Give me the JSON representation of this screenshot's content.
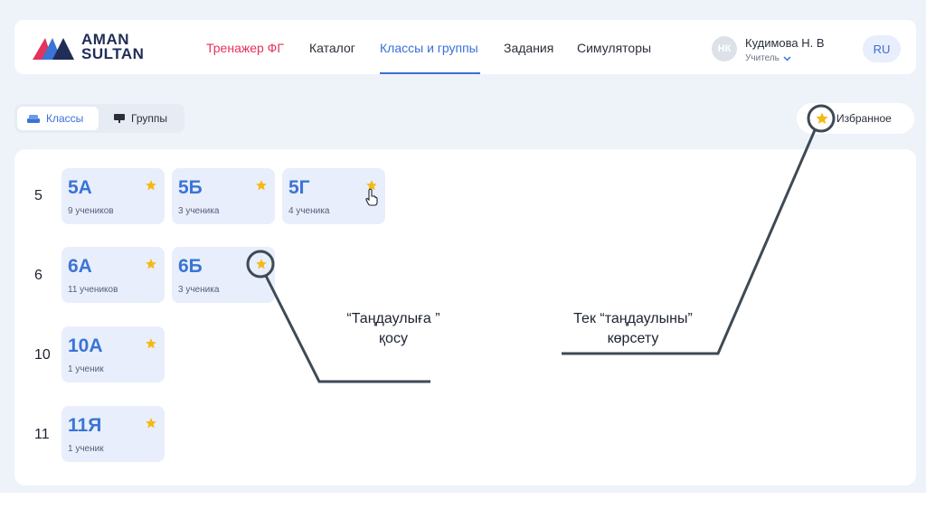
{
  "header": {
    "logo": {
      "line1": "AMAN",
      "line2": "SULTAN"
    },
    "nav": [
      {
        "label": "Тренажер ФГ"
      },
      {
        "label": "Каталог"
      },
      {
        "label": "Классы и группы"
      },
      {
        "label": "Задания"
      },
      {
        "label": "Симуляторы"
      }
    ],
    "user": {
      "initials": "НК",
      "name": "Кудимова Н. В",
      "role": "Учитель"
    },
    "lang": "RU"
  },
  "toggle": {
    "classes": "Классы",
    "groups": "Группы"
  },
  "favorites_button": "Избранное",
  "grades": [
    {
      "grade": "5",
      "classes": [
        {
          "name": "5А",
          "count": "9 учеников"
        },
        {
          "name": "5Б",
          "count": "3 ученика"
        },
        {
          "name": "5Г",
          "count": "4 ученика"
        }
      ]
    },
    {
      "grade": "6",
      "classes": [
        {
          "name": "6А",
          "count": "11 учеников"
        },
        {
          "name": "6Б",
          "count": "3 ученика"
        }
      ]
    },
    {
      "grade": "10",
      "classes": [
        {
          "name": "10А",
          "count": "1 ученик"
        }
      ]
    },
    {
      "grade": "11",
      "classes": [
        {
          "name": "11Я",
          "count": "1 ученик"
        }
      ]
    }
  ],
  "annotations": {
    "add_favorite": {
      "line1": "“Таңдаулыға ”",
      "line2": "қосу"
    },
    "show_favorites": {
      "line1": "Тек “таңдаулыны”",
      "line2": "көрсету"
    }
  },
  "colors": {
    "accent": "#3a6fd8",
    "brand_red": "#e2335b",
    "star": "#f5b915",
    "annotation_line": "#3e4a55"
  }
}
